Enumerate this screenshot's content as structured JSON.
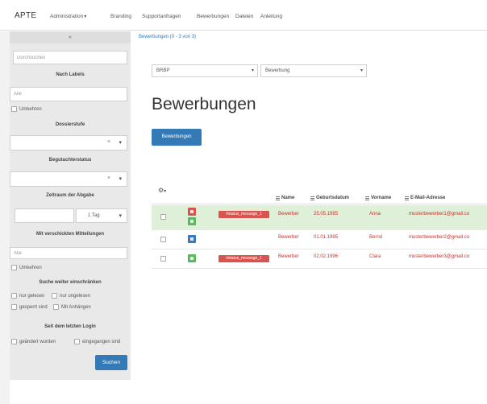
{
  "app": {
    "title": "APTE"
  },
  "nav": {
    "items": [
      {
        "label": "Administration",
        "has_dropdown": true
      },
      {
        "label": "Branding"
      },
      {
        "label": "Supportanfragen"
      },
      {
        "label": "Bewerbungen"
      },
      {
        "label": "Dateien"
      },
      {
        "label": "Anleitung"
      }
    ]
  },
  "icons": {
    "caret": "▾",
    "clear": "×",
    "collapse": "«",
    "gear": "⚙"
  },
  "breadcrumb": {
    "text": "Bewerbungen (0 - 3 von 3)"
  },
  "sidebar": {
    "search_placeholder": "Durchsuchen",
    "labels": {
      "heading": "Nach Labels",
      "placeholder": "Alle",
      "invert": "Umkehren"
    },
    "dossier": {
      "heading": "Dossierstufe"
    },
    "reviewer": {
      "heading": "Begutachterstatus"
    },
    "period": {
      "heading": "Zeitraum der Abgabe",
      "unit": "1 Tag"
    },
    "messages": {
      "heading": "Mit verschickten Mitteilungen",
      "placeholder": "Alle",
      "invert": "Umkehren"
    },
    "refine": {
      "heading": "Suche weiter einschränken",
      "options": [
        "nur gelesen",
        "nur ungelesen",
        "gesperrt sind",
        "Mit Anhängen"
      ]
    },
    "since_login": {
      "heading": "Seit dem letzten Login",
      "options": [
        "geändert wurden",
        "eingegangen sind"
      ]
    },
    "search_button": "Suchen"
  },
  "main": {
    "filter_selects": [
      "BRBP",
      "Bewerbung"
    ],
    "title": "Bewerbungen",
    "action_button": "Bewerbungen",
    "table": {
      "columns": [
        "Name",
        "Geburtsdatum",
        "Vorname",
        "E-Mail-Adresse"
      ],
      "rows": [
        {
          "background": "#dff0d8",
          "badges": [
            {
              "color": "#d9534f"
            },
            {
              "color": "#5cb85c"
            }
          ],
          "label": "#status_message_1",
          "name": "Bewerber",
          "birthdate": "25.05.1995",
          "first_name": "Anna",
          "email": "musterbewerber1@gmail.co"
        },
        {
          "badges": [
            {
              "color": "#3a78c2"
            }
          ],
          "name": "Bewerber",
          "birthdate": "01.01.1995",
          "first_name": "Bernd",
          "email": "musterbewerber2@gmail.co"
        },
        {
          "badges": [
            {
              "color": "#5cb85c"
            }
          ],
          "label": "#status_message_1",
          "name": "Bewerber",
          "birthdate": "02.02.1996",
          "first_name": "Clara",
          "email": "musterbewerber3@gmail.co"
        }
      ]
    }
  },
  "colors": {
    "accent": "#337ab7",
    "sidebar_bg": "#e9e9e9",
    "sidebar_head_bg": "#dedede",
    "gutter_bg": "#f2f2f2",
    "danger": "#d9534f",
    "row_text": "#c9302c",
    "success": "#5cb85c"
  }
}
